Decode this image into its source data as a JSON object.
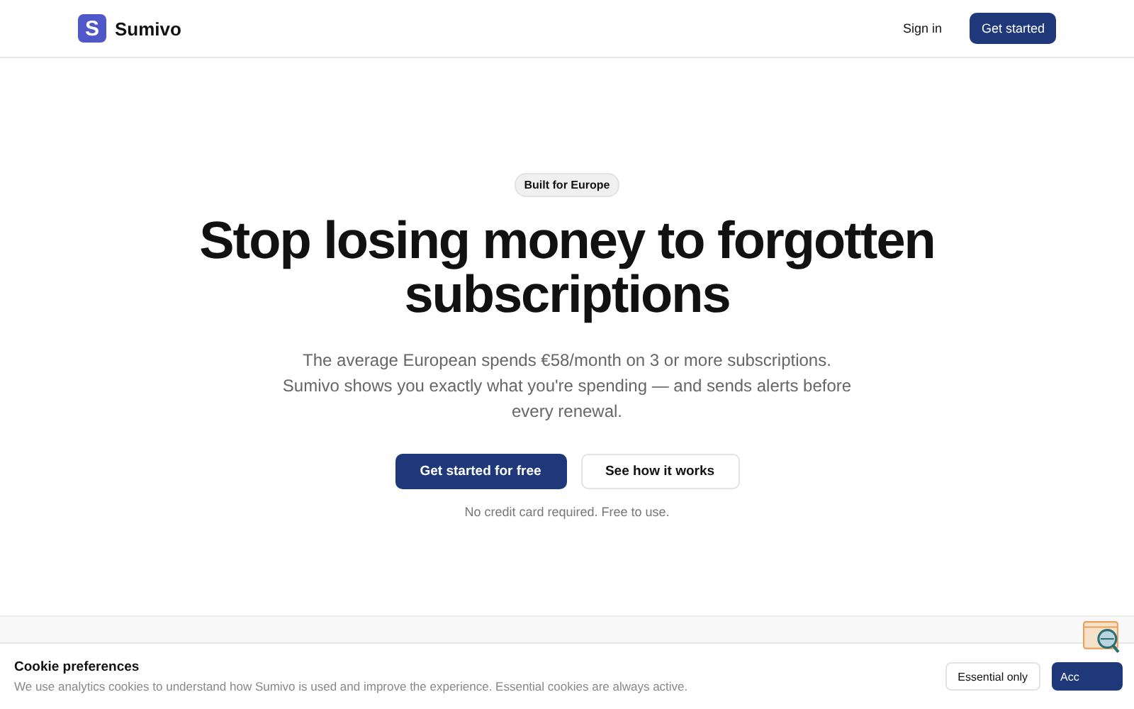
{
  "header": {
    "logo_letter": "S",
    "brand": "Sumivo",
    "sign_in": "Sign in",
    "cta": "Get started"
  },
  "hero": {
    "badge": "Built for Europe",
    "title": "Stop losing money to forgotten subscriptions",
    "subtitle": "The average European spends €58/month on 3 or more subscriptions. Sumivo shows you exactly what you're spending — and sends alerts before every renewal.",
    "primary_button": "Get started for free",
    "secondary_button": "See how it works",
    "note": "No credit card required. Free to use."
  },
  "cookie_banner": {
    "title": "Cookie preferences",
    "text": "We use analytics cookies to understand how Sumivo is used and improve the experience. Essential cookies are always active.",
    "buttons": [
      {
        "label": "Essential only",
        "kind": "secondary"
      },
      {
        "label": "Acc",
        "kind": "primary"
      }
    ]
  }
}
